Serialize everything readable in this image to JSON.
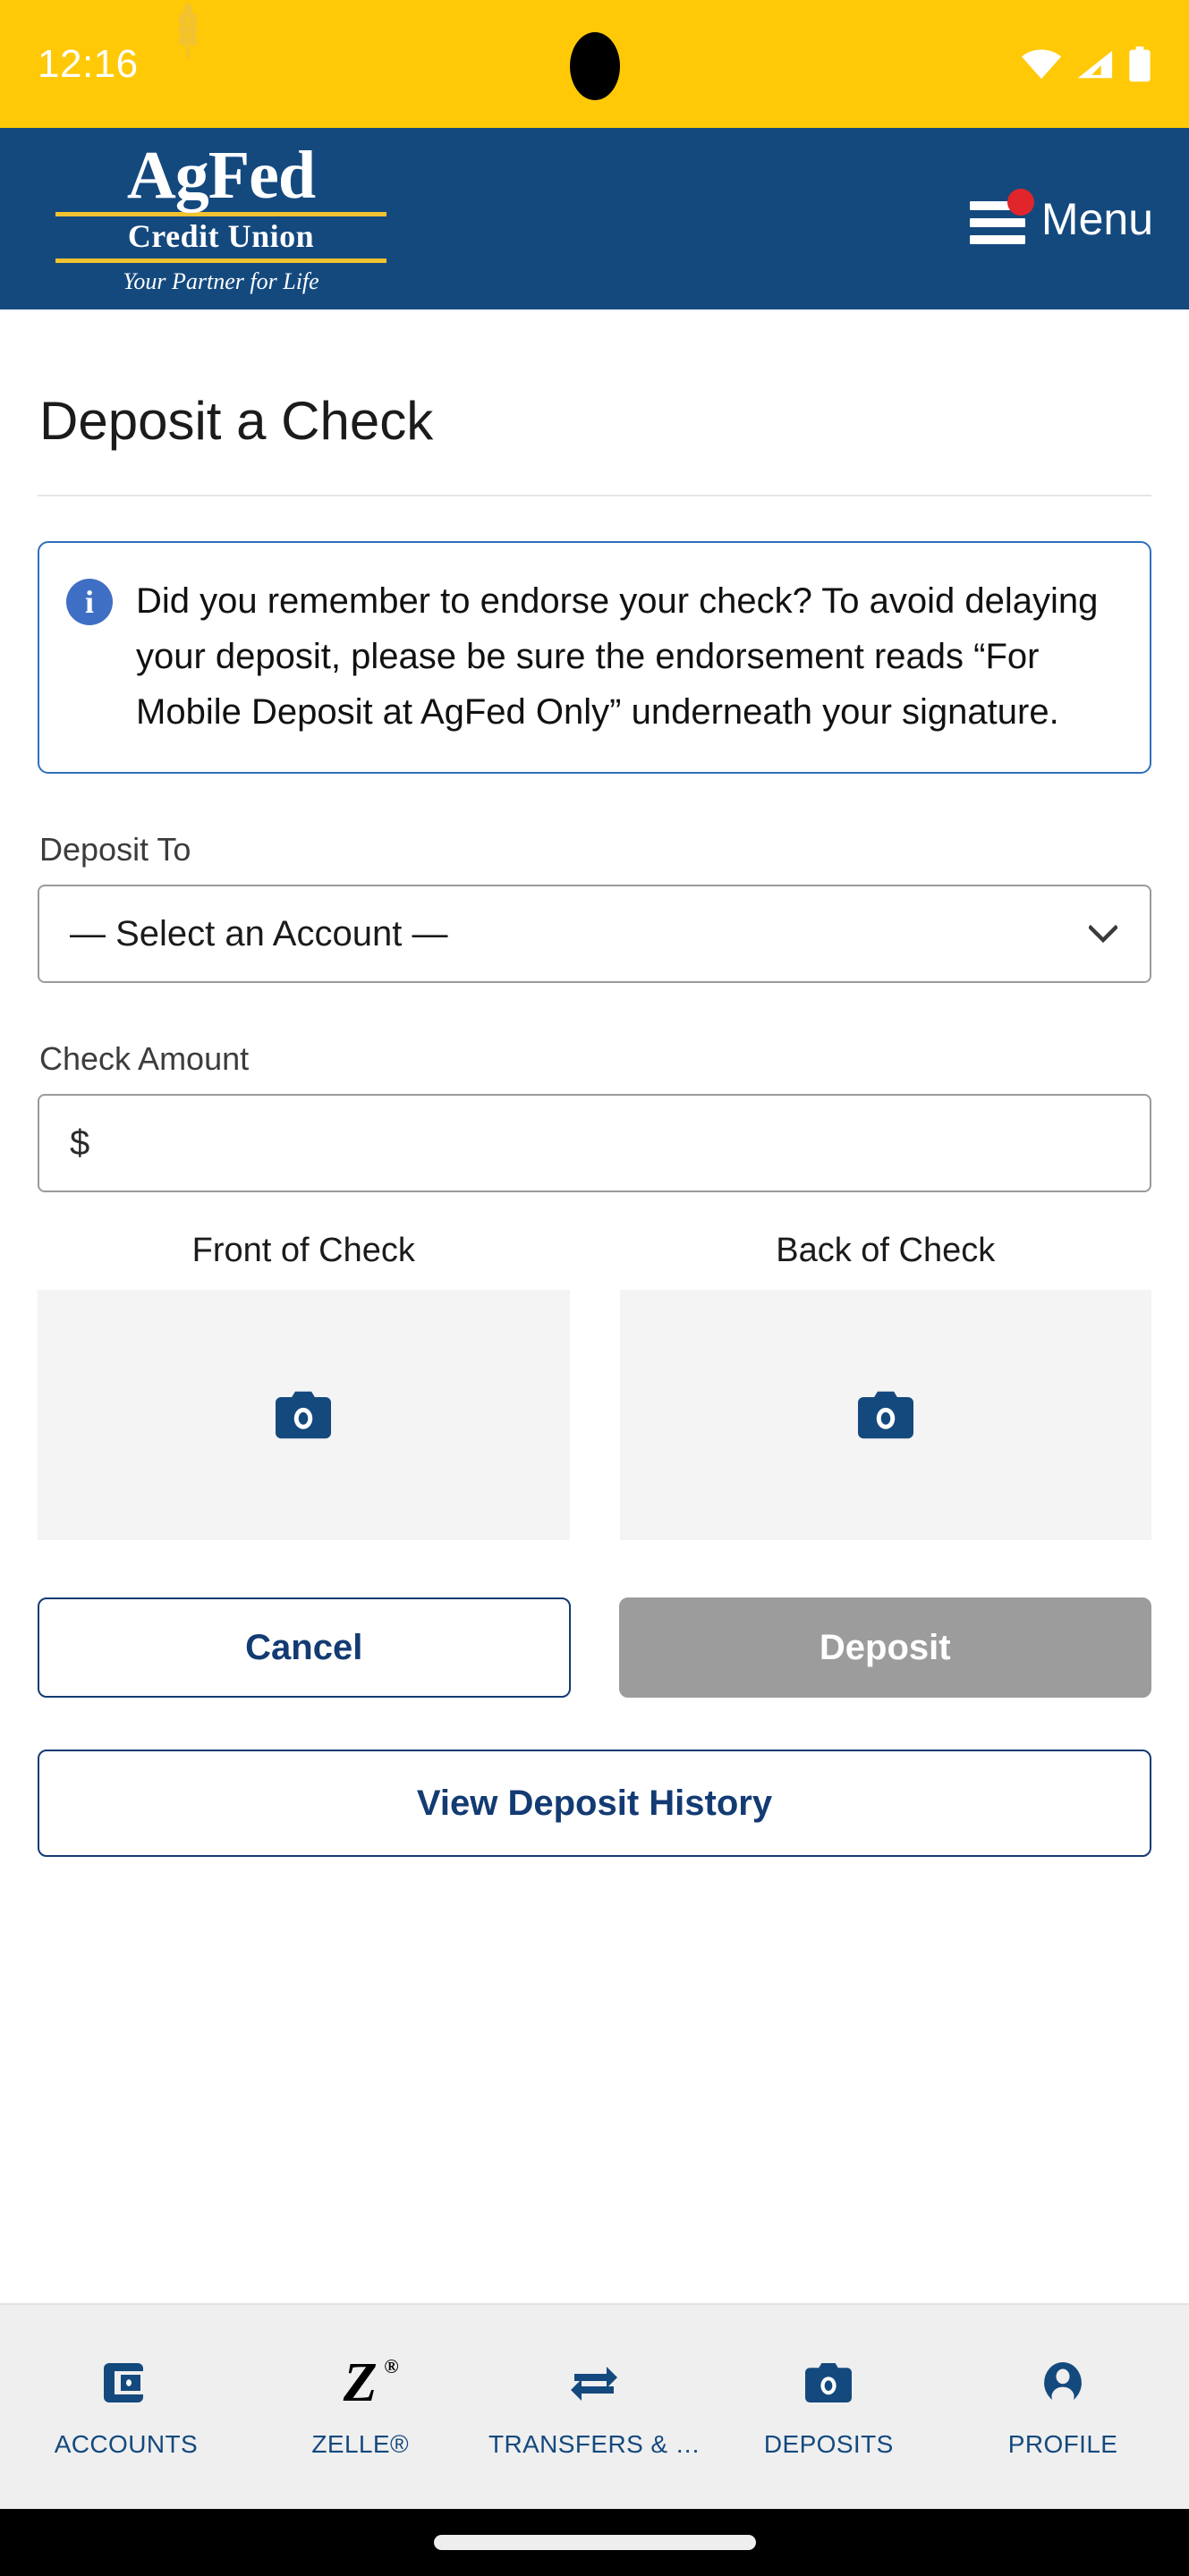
{
  "status_bar": {
    "time": "12:16",
    "icons": [
      "wifi-icon",
      "cellular-signal-icon",
      "battery-icon"
    ]
  },
  "header": {
    "logo_main": "AgFed",
    "logo_sub": "Credit Union",
    "logo_tagline": "Your Partner for Life",
    "menu_label": "Menu",
    "has_notification_badge": true
  },
  "page": {
    "title": "Deposit a Check"
  },
  "alert": {
    "icon": "info-icon",
    "text": "Did you remember to endorse your check? To avoid delaying your deposit, please be sure the endorsement reads “For Mobile Deposit at AgFed Only” underneath your signature."
  },
  "form": {
    "deposit_to_label": "Deposit To",
    "deposit_to_value": "— Select an Account —",
    "check_amount_label": "Check Amount",
    "check_amount_prefix": "$",
    "check_amount_value": "",
    "check_amount_placeholder": ""
  },
  "captures": [
    {
      "label": "Front of Check",
      "icon": "camera-icon"
    },
    {
      "label": "Back of Check",
      "icon": "camera-icon"
    }
  ],
  "actions": {
    "cancel_label": "Cancel",
    "deposit_label": "Deposit",
    "deposit_disabled": true,
    "history_label": "View Deposit History"
  },
  "bottom_nav": [
    {
      "label": "ACCOUNTS",
      "icon": "wallet-icon"
    },
    {
      "label": "ZELLE®",
      "icon": "zelle-icon"
    },
    {
      "label": "TRANSFERS & …",
      "icon": "transfer-arrows-icon"
    },
    {
      "label": "DEPOSITS",
      "icon": "camera-icon"
    },
    {
      "label": "PROFILE",
      "icon": "person-icon"
    }
  ],
  "colors": {
    "status_bar_yellow": "#FFC907",
    "header_navy": "#14497E",
    "brand_navy": "#133B73",
    "alert_border_blue": "#2f6fba",
    "info_icon_blue": "#3F6FC4",
    "badge_red": "#E0252B",
    "disabled_gray": "#9C9C9C",
    "logo_gold": "#F2C230"
  }
}
